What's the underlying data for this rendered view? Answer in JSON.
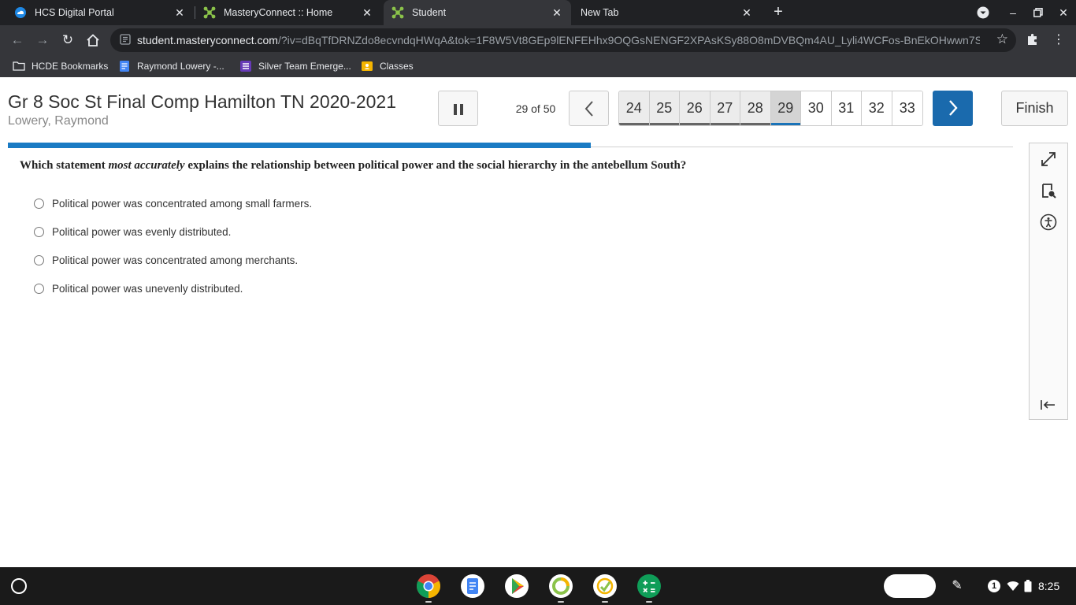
{
  "tabs": [
    {
      "label": "HCS Digital Portal",
      "close": "✕"
    },
    {
      "label": "MasteryConnect :: Home",
      "close": "✕"
    },
    {
      "label": "Student",
      "close": "✕"
    },
    {
      "label": "New Tab",
      "close": "✕"
    }
  ],
  "address": {
    "host": "student.masteryconnect.com",
    "path": "/?iv=dBqTfDRNZdo8ecvndqHWqA&tok=1F8W5Vt8GEp9lENFEHhx9OQGsNENGF2XPAsKSy88O8mDVBQm4AU_Lyli4WCFos-BnEkOHwwn7Ss..."
  },
  "bookmarks": [
    {
      "label": "HCDE Bookmarks"
    },
    {
      "label": "Raymond Lowery -..."
    },
    {
      "label": "Silver Team Emerge..."
    },
    {
      "label": "Classes"
    }
  ],
  "assessment": {
    "title": "Gr 8 Soc St Final Comp Hamilton TN 2020-2021",
    "student": "Lowery, Raymond",
    "counter": "29 of 50",
    "current": 29,
    "total": 50,
    "finish_label": "Finish",
    "questions_nav": [
      {
        "num": "24",
        "state": "answered"
      },
      {
        "num": "25",
        "state": "answered"
      },
      {
        "num": "26",
        "state": "answered"
      },
      {
        "num": "27",
        "state": "answered"
      },
      {
        "num": "28",
        "state": "answered"
      },
      {
        "num": "29",
        "state": "current"
      },
      {
        "num": "30",
        "state": "unanswered"
      },
      {
        "num": "31",
        "state": "unanswered"
      },
      {
        "num": "32",
        "state": "unanswered"
      },
      {
        "num": "33",
        "state": "unanswered"
      }
    ],
    "progress_fraction": 0.58
  },
  "question": {
    "prefix": "Which statement ",
    "emphasis": "most accurately",
    "suffix": " explains the relationship between political power and the social hierarchy in the antebellum South?",
    "options": [
      "Political power was concentrated among small farmers.",
      "Political power was evenly distributed.",
      "Political power was concentrated among merchants.",
      "Political power was unevenly distributed."
    ]
  },
  "status": {
    "notification_count": "1",
    "time": "8:25"
  },
  "colors": {
    "accent": "#1a6aad",
    "progress": "#1a7bc4",
    "chrome_dark": "#202124",
    "chrome_toolbar": "#35363a"
  }
}
